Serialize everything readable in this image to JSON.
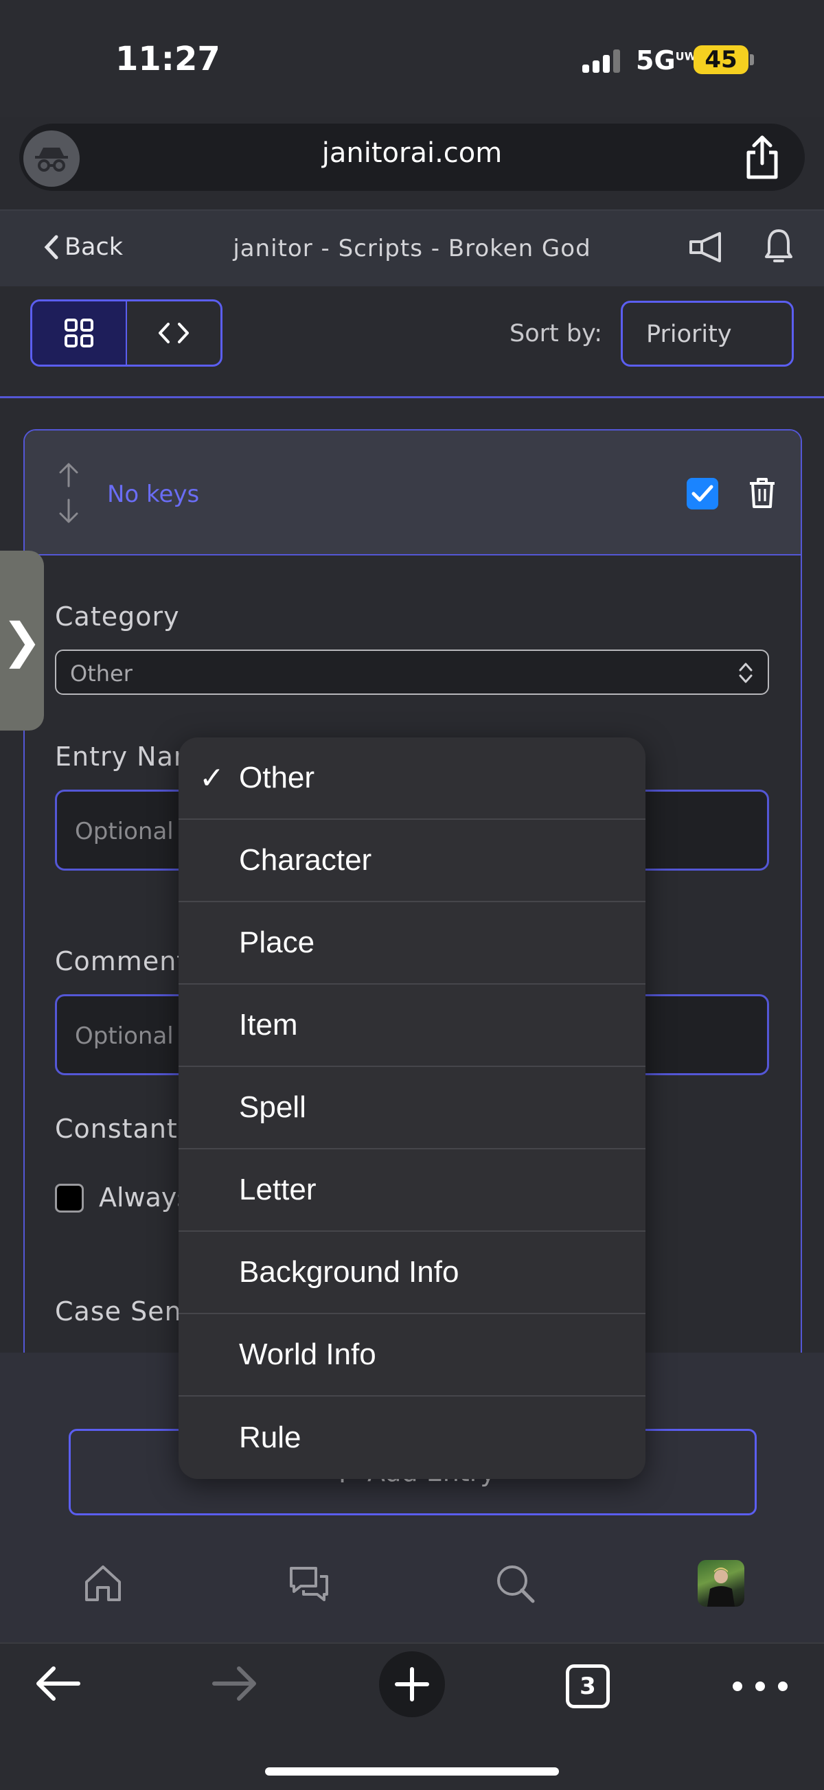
{
  "status_bar": {
    "time": "11:27",
    "network": "5G",
    "network_suffix": "UW",
    "battery": "45"
  },
  "browser": {
    "url": "janitorai.com",
    "tab_count": "3"
  },
  "header": {
    "back_label": "Back",
    "title": "janitor - Scripts - Broken God"
  },
  "toolbar": {
    "sort_label": "Sort by:",
    "sort_value": "Priority"
  },
  "entry": {
    "keys_text": "No keys",
    "enabled": true,
    "category_label": "Category",
    "category_value": "Other",
    "entry_name_label": "Entry Name",
    "entry_name_placeholder": "Optional",
    "comment_label": "Comment",
    "comment_placeholder": "Optional",
    "constant_label": "Constant",
    "always_label": "Always",
    "case_label": "Case Sensitive"
  },
  "add_entry_label": "Add Entry",
  "dropdown": {
    "selected": "Other",
    "options": [
      "Other",
      "Character",
      "Place",
      "Item",
      "Spell",
      "Letter",
      "Background Info",
      "World Info",
      "Rule"
    ]
  },
  "colors": {
    "accent": "#5b5ef0",
    "checkbox": "#1a84ff",
    "battery": "#f5d020"
  }
}
